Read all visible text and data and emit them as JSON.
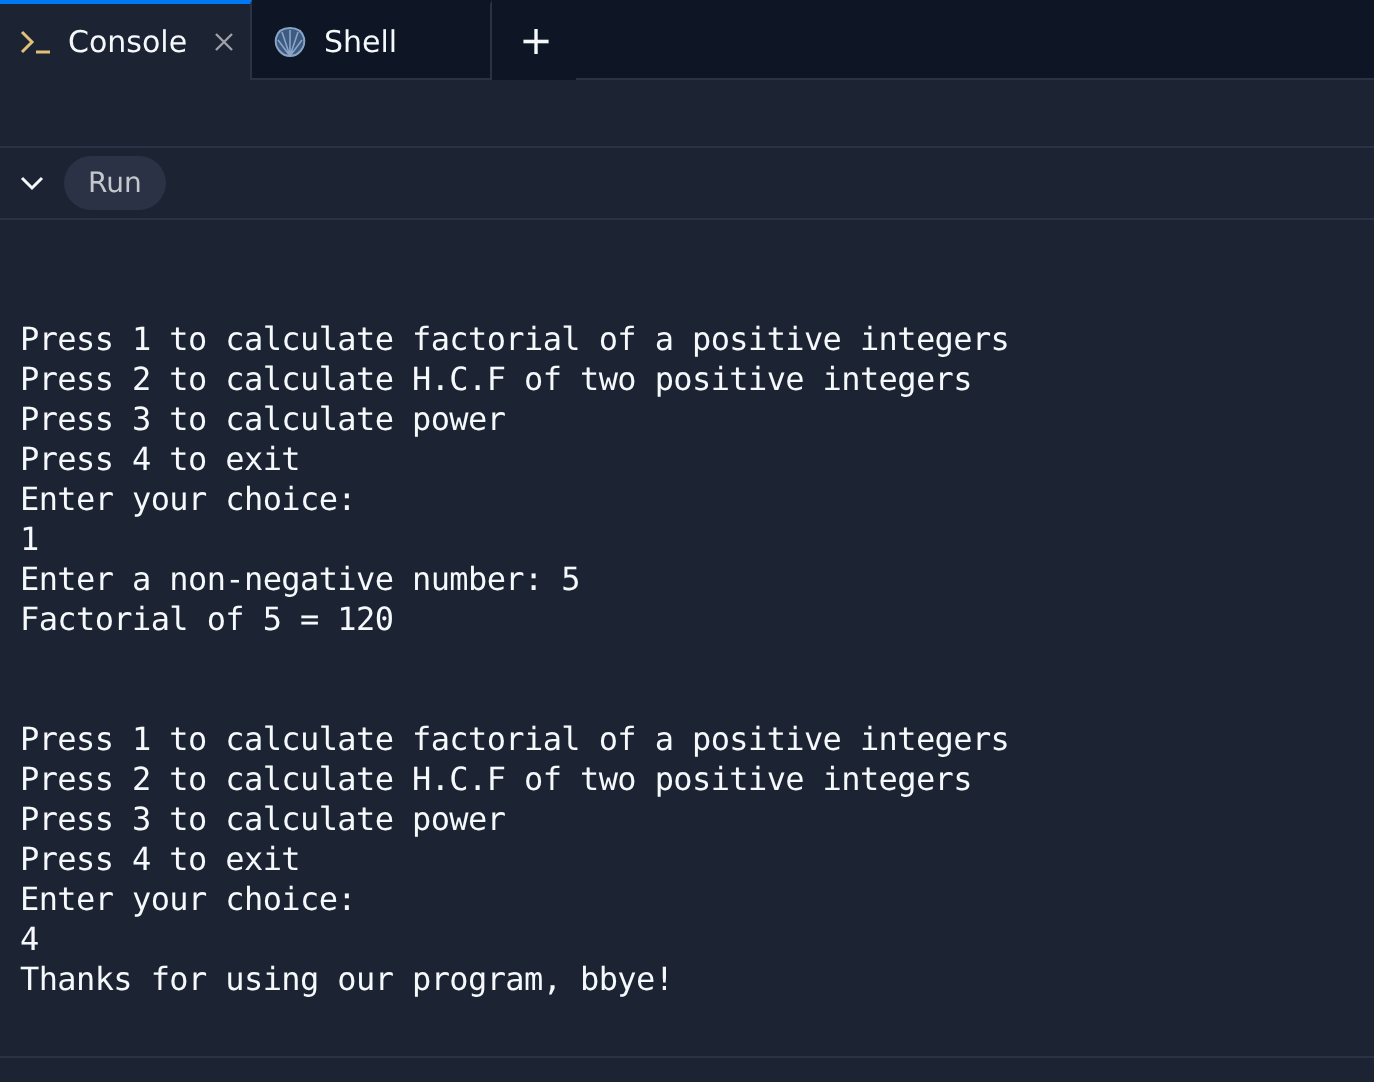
{
  "tabs": [
    {
      "label": "Console",
      "kind": "console",
      "selected": true
    },
    {
      "label": "Shell",
      "kind": "shell",
      "selected": false
    }
  ],
  "add_tab": "+",
  "toolbar": {
    "run_label": "Run"
  },
  "console": {
    "blocks": [
      [
        "Press 1 to calculate factorial of a positive integers",
        "Press 2 to calculate H.C.F of two positive integers",
        "Press 3 to calculate power",
        "Press 4 to exit",
        "Enter your choice:",
        "1",
        "Enter a non-negative number: 5",
        "Factorial of 5 = 120"
      ],
      [
        "Press 1 to calculate factorial of a positive integers",
        "Press 2 to calculate H.C.F of two positive integers",
        "Press 3 to calculate power",
        "Press 4 to exit",
        "Enter your choice:",
        "4",
        "Thanks for using our program, bbye!"
      ]
    ]
  }
}
